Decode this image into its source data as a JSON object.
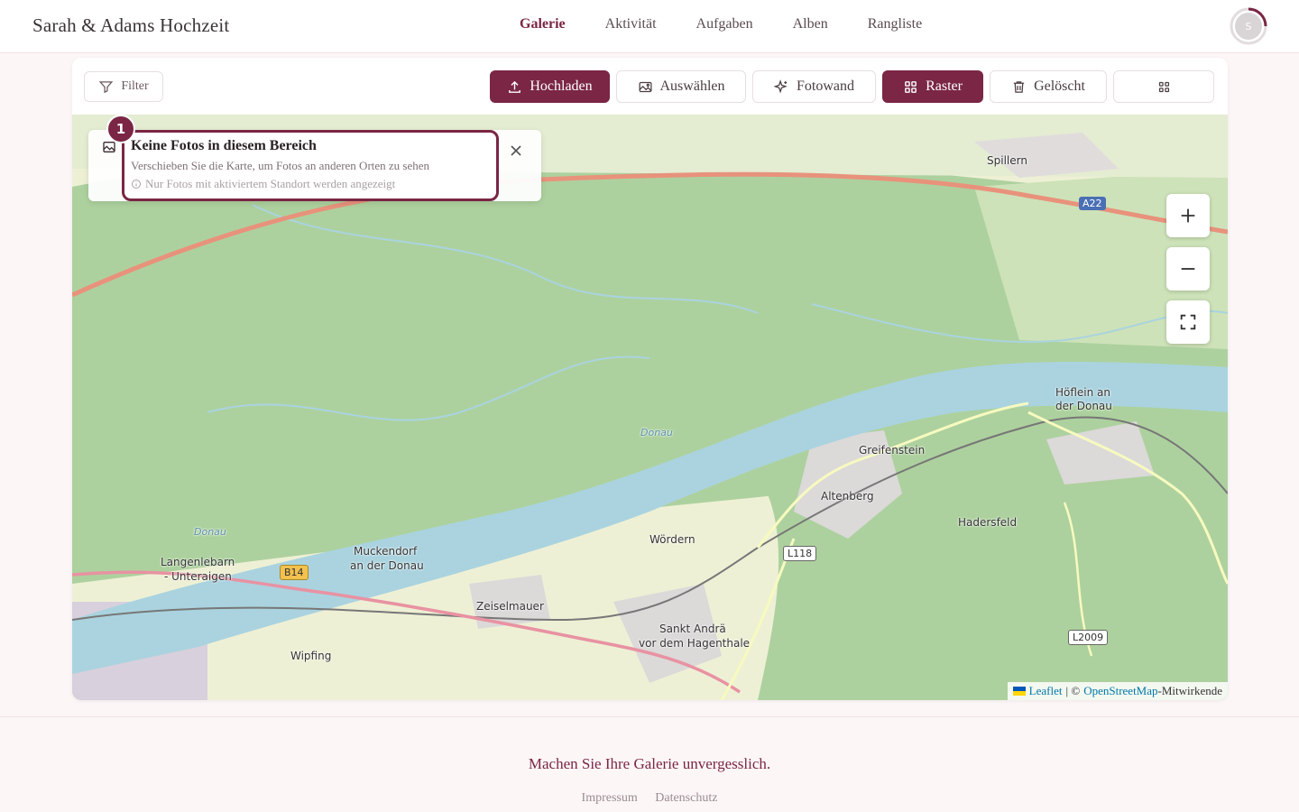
{
  "header": {
    "brand": "Sarah & Adams Hochzeit",
    "nav": [
      {
        "label": "Galerie",
        "active": true
      },
      {
        "label": "Aktivität",
        "active": false
      },
      {
        "label": "Aufgaben",
        "active": false
      },
      {
        "label": "Alben",
        "active": false
      },
      {
        "label": "Rangliste",
        "active": false
      }
    ],
    "avatar_initial": "S"
  },
  "toolbar": {
    "filter": "Filter",
    "upload": "Hochladen",
    "select": "Auswählen",
    "photowall": "Fotowand",
    "grid": "Raster",
    "deleted": "Gelöscht"
  },
  "popup": {
    "badge": "1",
    "title": "Keine Fotos in diesem Bereich",
    "subtitle": "Verschieben Sie die Karte, um Fotos an anderen Orten zu sehen",
    "hint": "Nur Fotos mit aktiviertem Standort werden angezeigt"
  },
  "map": {
    "labels": {
      "spillern": "Spillern",
      "hoflein": "Höflein an",
      "hoflein2": "der Donau",
      "greifenstein": "Greifenstein",
      "altenberg": "Altenberg",
      "wordern": "Wördern",
      "muckendorf": "Muckendorf",
      "muckendorf2": "an der Donau",
      "langenlebarn": "Langenlebarn",
      "unteraigen": "- Unteraigen",
      "zeiselmauer": "Zeiselmauer",
      "sanktandra": "Sankt Andrä",
      "sanktandra2": "vor dem Hagenthale",
      "wipfing": "Wipfing",
      "hadersfeld": "Hadersfeld",
      "donau1": "Donau",
      "donau2": "Donau",
      "a22": "A22",
      "b14": "B14",
      "l118": "L118",
      "l2009": "L2009"
    },
    "attribution": {
      "leaflet": "Leaflet",
      "sep": "| ©",
      "osm": "OpenStreetMap",
      "suffix": "-Mitwirkende"
    }
  },
  "footer": {
    "tagline": "Machen Sie Ihre Galerie unvergesslich.",
    "impressum": "Impressum",
    "datenschutz": "Datenschutz"
  },
  "colors": {
    "accent": "#7a2644",
    "river": "#aad3df",
    "forest": "#add19e",
    "field": "#eef0d5"
  }
}
